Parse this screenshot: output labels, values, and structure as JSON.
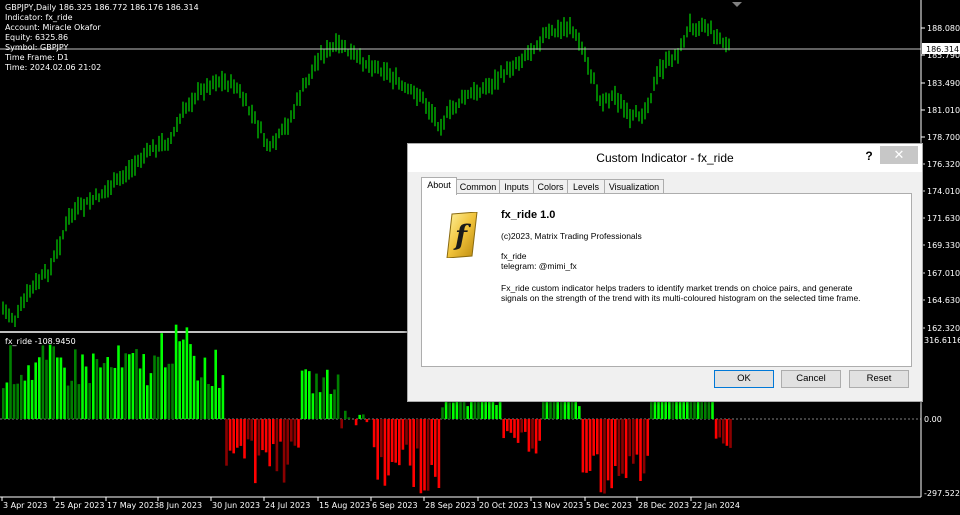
{
  "info": {
    "symbol_line": "GBPJPY,Daily  186.325 186.772 186.176 186.314",
    "indicator": "Indicator: fx_ride",
    "account": "Account: Miracle Okafor",
    "equity": "Equity: 6325.86",
    "symbol": "Symbol: GBPJPY",
    "timeframe": "Time Frame: D1",
    "time": "Time: 2024.02.06 21:02"
  },
  "subwindow_label": "fx_ride -108.9450",
  "price_axis": [
    "188.080",
    "185.790",
    "183.490",
    "181.010",
    "178.700",
    "176.320",
    "174.010",
    "171.630",
    "169.330",
    "167.010",
    "164.630",
    "162.320"
  ],
  "current_price": "186.314",
  "sub_axis": [
    "316.6116",
    "0.00",
    "-297.5229"
  ],
  "date_axis": [
    "3 Apr 2023",
    "25 Apr 2023",
    "17 May 2023",
    "8 Jun 2023",
    "30 Jun 2023",
    "24 Jul 2023",
    "15 Aug 2023",
    "6 Sep 2023",
    "28 Sep 2023",
    "20 Oct 2023",
    "13 Nov 2023",
    "5 Dec 2023",
    "28 Dec 2023",
    "22 Jan 2024"
  ],
  "colors": {
    "bull": "#00ff00",
    "bear": "#ff0000",
    "hist_strong_up": "#00ff00",
    "hist_weak_up": "#008000",
    "hist_down": "#ff0000",
    "hist_weak_down": "#8b0000"
  },
  "dialog": {
    "title": "Custom Indicator - fx_ride",
    "help": "?",
    "close": "✕",
    "tabs": [
      "About",
      "Common",
      "Inputs",
      "Colors",
      "Levels",
      "Visualization"
    ],
    "name": "fx_ride 1.0",
    "copyright": "(c)2023, Matrix Trading Professionals",
    "line1": "fx_ride",
    "line2": "telegram: @mimi_fx",
    "desc1": "Fx_ride custom indicator helps traders to identify market trends on choice pairs, and generate",
    "desc2": "signals on the strength of the trend with its multi-coloured histogram on the selected time frame.",
    "ok": "OK",
    "cancel": "Cancel",
    "reset": "Reset"
  }
}
